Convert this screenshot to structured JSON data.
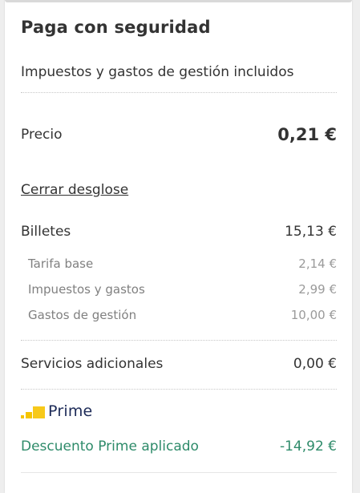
{
  "payment": {
    "title": "Paga con seguridad",
    "subtitle": "Impuestos y gastos de gestión incluidos",
    "price_label": "Precio",
    "price_value": "0,21 €",
    "toggle_breakdown": "Cerrar desglose"
  },
  "breakdown": {
    "tickets_label": "Billetes",
    "tickets_value": "15,13 €",
    "items": [
      {
        "label": "Tarifa base",
        "value": "2,14 €"
      },
      {
        "label": "Impuestos y gastos",
        "value": "2,99 €"
      },
      {
        "label": "Gastos de gestión",
        "value": "10,00 €"
      }
    ],
    "services_label": "Servicios adicionales",
    "services_value": "0,00 €"
  },
  "prime": {
    "logo_text": "Prime",
    "discount_label": "Descuento Prime aplicado",
    "discount_value": "-14,92 €"
  },
  "colors": {
    "accent_green": "#2e8b6a",
    "prime_yellow": "#f5c400",
    "prime_navy": "#1c2a57"
  }
}
